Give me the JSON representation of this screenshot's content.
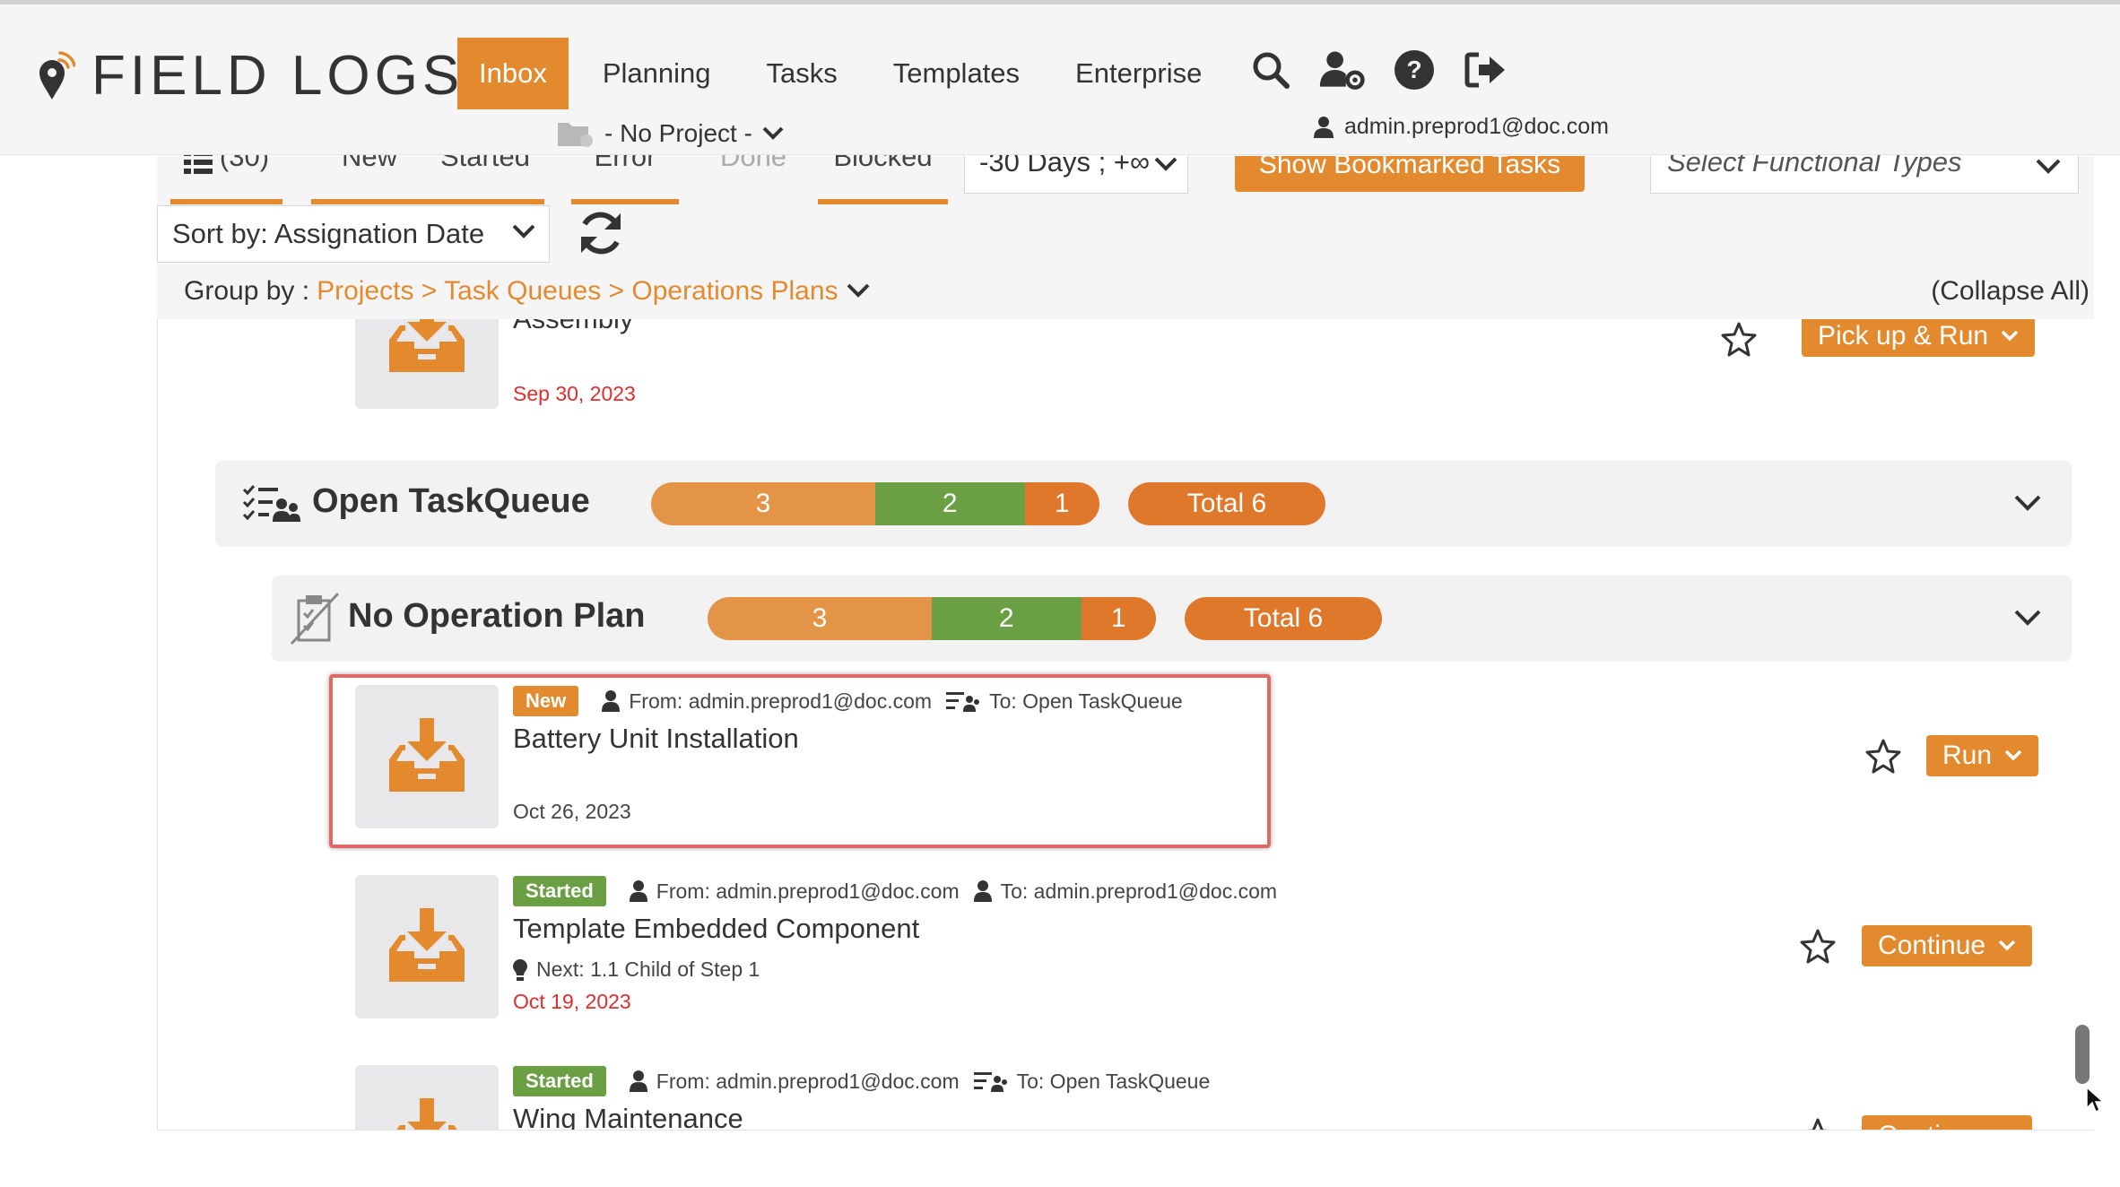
{
  "brand": {
    "name": "FIELD LOGS"
  },
  "nav": {
    "items": [
      {
        "label": "Inbox",
        "active": true
      },
      {
        "label": "Planning"
      },
      {
        "label": "Tasks"
      },
      {
        "label": "Templates"
      },
      {
        "label": "Enterprise"
      }
    ],
    "icons": [
      "search-icon",
      "user-settings-icon",
      "help-icon",
      "logout-icon"
    ]
  },
  "project_selector": {
    "label": "- No Project -"
  },
  "user": {
    "email": "admin.preprod1@doc.com"
  },
  "filters": {
    "tabs": [
      {
        "label": "(30)",
        "icon": "list-icon"
      },
      {
        "label": "New"
      },
      {
        "label": "Started"
      },
      {
        "label": "Error"
      },
      {
        "label": "Done"
      },
      {
        "label": "Blocked"
      }
    ],
    "range": "-30 Days ; +∞",
    "bookmark_button": "Show Bookmarked Tasks",
    "functional_types_placeholder": "Select Functional Types",
    "sort_by": "Sort by: Assignation Date"
  },
  "group_by": {
    "label": "Group by :",
    "path": "Projects > Task Queues > Operations Plans",
    "collapse_all": "(Collapse All)"
  },
  "partial_task": {
    "title": "Assembly",
    "date": "Sep 30, 2023",
    "action": "Pick up & Run"
  },
  "taskqueue_group": {
    "title": "Open TaskQueue",
    "counts": {
      "new": "3",
      "started": "2",
      "blocked": "1"
    },
    "total": "Total 6"
  },
  "opplan_group": {
    "title": "No Operation Plan",
    "counts": {
      "new": "3",
      "started": "2",
      "blocked": "1"
    },
    "total": "Total 6"
  },
  "tasks": [
    {
      "status": "New",
      "from": "From: admin.preprod1@doc.com",
      "to": "To: Open TaskQueue",
      "title": "Battery Unit Installation",
      "date": "Oct 26, 2023",
      "action": "Run"
    },
    {
      "status": "Started",
      "from": "From: admin.preprod1@doc.com",
      "to": "To: admin.preprod1@doc.com",
      "title": "Template Embedded Component",
      "next": "Next: 1.1 Child of Step 1",
      "date": "Oct 19, 2023",
      "action": "Continue"
    },
    {
      "status": "Started",
      "from": "From: admin.preprod1@doc.com",
      "to": "To: Open TaskQueue",
      "title": "Wing Maintenance",
      "action": "Continue"
    }
  ],
  "colors": {
    "accent": "#e38a2e",
    "started_green": "#6aa043",
    "overdue_red": "#e02d2d",
    "highlight": "#e06a63"
  }
}
